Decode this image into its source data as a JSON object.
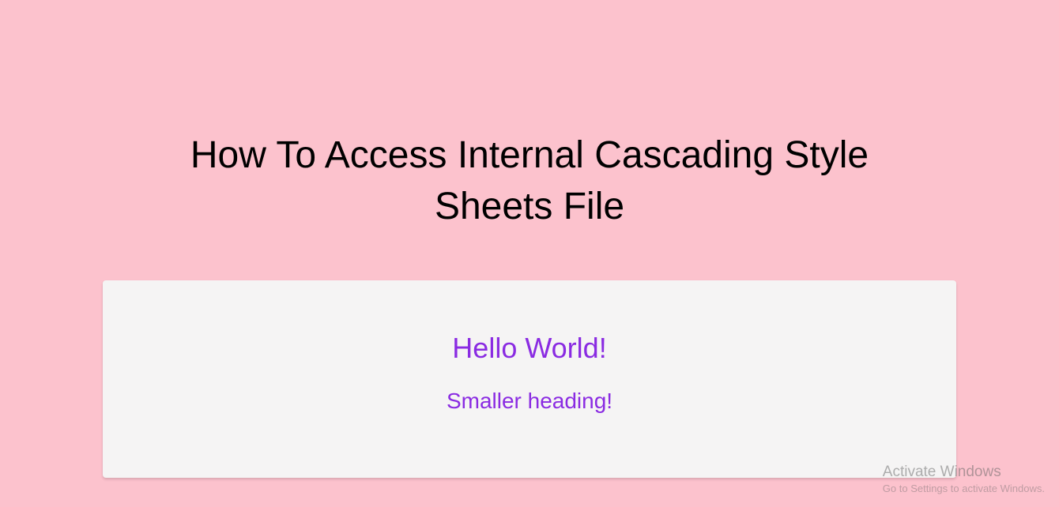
{
  "main": {
    "title": "How To Access Internal Cascading Style Sheets File"
  },
  "box": {
    "heading": "Hello World!",
    "subheading": "Smaller heading!"
  },
  "watermark": {
    "title": "Activate Windows",
    "sub": "Go to Settings to activate Windows."
  }
}
